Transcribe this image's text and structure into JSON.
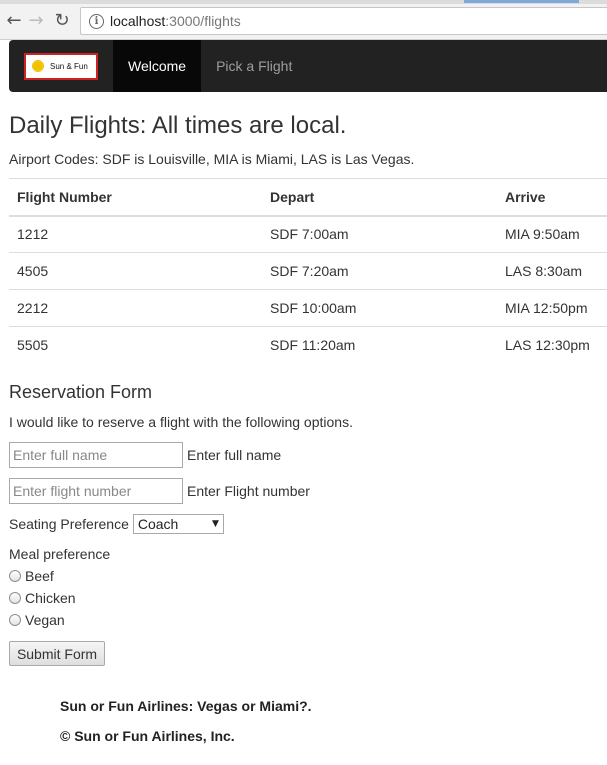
{
  "browser": {
    "url_host": "localhost",
    "url_path": ":3000/flights",
    "info_glyph": "i"
  },
  "navbar": {
    "brand_text": "Sun & Fun",
    "items": [
      {
        "label": "Welcome",
        "active": true
      },
      {
        "label": "Pick a Flight",
        "active": false
      }
    ]
  },
  "page": {
    "title": "Daily Flights: All times are local.",
    "codes_note": "Airport Codes: SDF is Louisville, MIA is Miami, LAS is Las Vegas."
  },
  "flights_table": {
    "headers": [
      "Flight Number",
      "Depart",
      "Arrive"
    ],
    "rows": [
      [
        "1212",
        "SDF 7:00am",
        "MIA 9:50am"
      ],
      [
        "4505",
        "SDF 7:20am",
        "LAS 8:30am"
      ],
      [
        "2212",
        "SDF 10:00am",
        "MIA 12:50pm"
      ],
      [
        "5505",
        "SDF 11:20am",
        "LAS 12:30pm"
      ]
    ]
  },
  "form": {
    "title": "Reservation Form",
    "intro": "I would like to reserve a flight with the following options.",
    "name_placeholder": "Enter full name",
    "name_value": "",
    "name_label": "Enter full name",
    "flight_placeholder": "Enter flight number",
    "flight_value": "",
    "flight_label": "Enter Flight number",
    "seating_label": "Seating Preference",
    "seating_selected": "Coach",
    "meal_label": "Meal preference",
    "meals": [
      "Beef",
      "Chicken",
      "Vegan"
    ],
    "submit_label": "Submit Form"
  },
  "footer": {
    "tagline": "Sun or Fun Airlines: Vegas or Miami?.",
    "copyright": "© Sun or Fun Airlines, Inc."
  },
  "colors": {
    "navbar_bg": "#222222",
    "navbar_active": "#080808",
    "logo_border": "#cc2222",
    "sun": "#f2c200"
  }
}
